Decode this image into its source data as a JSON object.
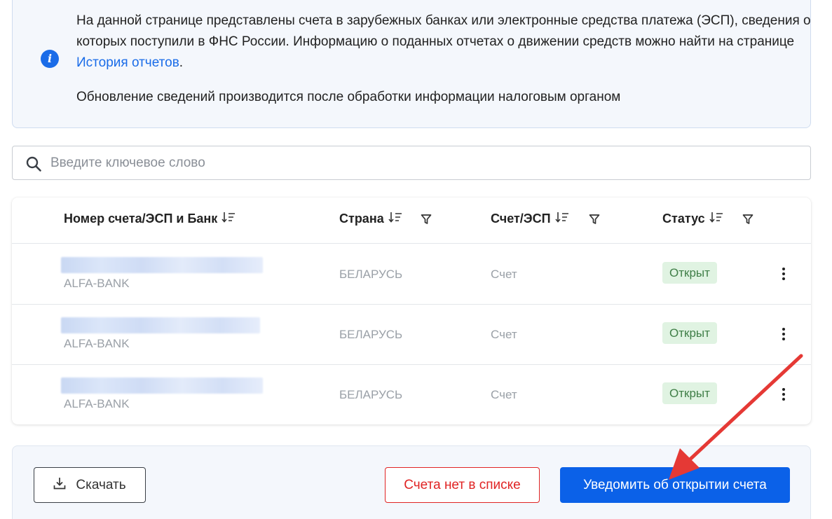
{
  "info": {
    "line1": "На данной странице представлены счета в зарубежных банках или электронные средства платежа (ЭСП), сведения о которых поступили в ФНС России. Информацию о поданных отчетах о движении средств можно найти на странице ",
    "link": "История отчетов",
    "line1_end": ".",
    "line2": "Обновление сведений производится после обработки информации налоговым органом"
  },
  "search": {
    "placeholder": "Введите ключевое слово"
  },
  "table": {
    "headers": {
      "account": "Номер счета/ЭСП и Банк",
      "country": "Страна",
      "type": "Счет/ЭСП",
      "status": "Статус"
    },
    "rows": [
      {
        "bank": "ALFA-BANK",
        "country": "БЕЛАРУСЬ",
        "type": "Счет",
        "status": "Открыт"
      },
      {
        "bank": "ALFA-BANK",
        "country": "БЕЛАРУСЬ",
        "type": "Счет",
        "status": "Открыт"
      },
      {
        "bank": "ALFA-BANK",
        "country": "БЕЛАРУСЬ",
        "type": "Счет",
        "status": "Открыт"
      }
    ]
  },
  "footer": {
    "download": "Скачать",
    "not_in_list": "Счета нет в списке",
    "notify": "Уведомить об открытии счета"
  },
  "colors": {
    "primary": "#0b61e8",
    "danger": "#e02424",
    "status_bg": "#e0f3e2",
    "annotation_arrow": "#e53935"
  }
}
